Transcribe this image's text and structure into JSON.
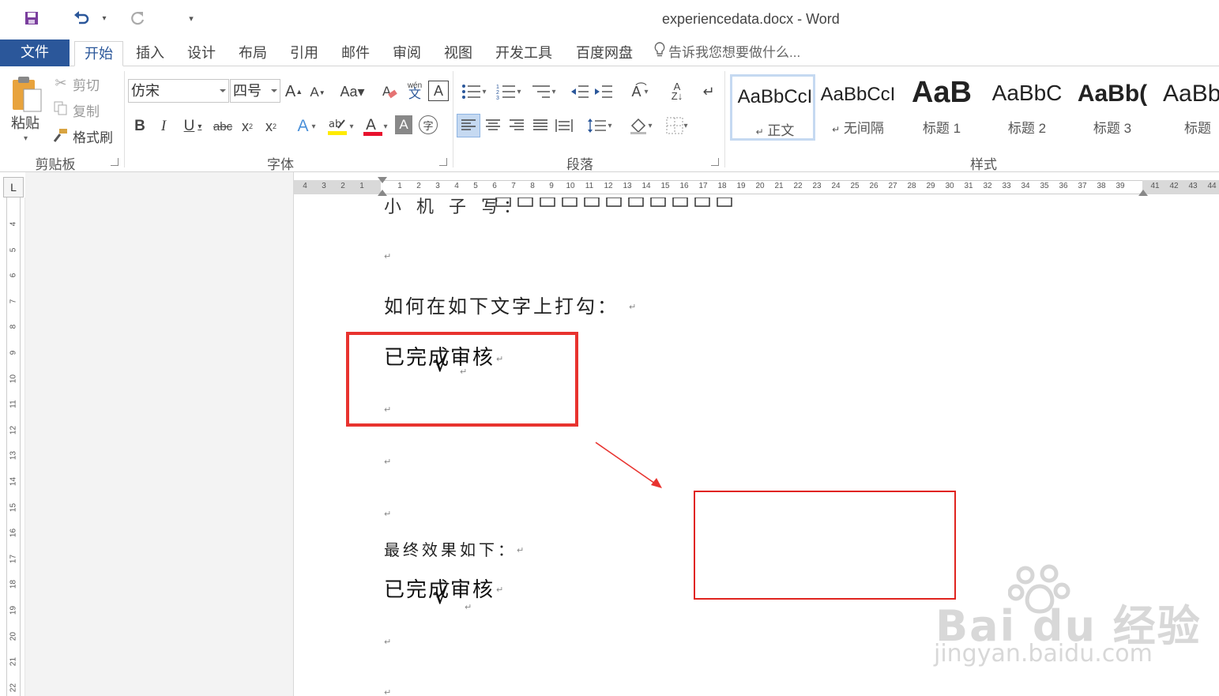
{
  "window": {
    "title": "experiencedata.docx - Word"
  },
  "tabs": [
    "文件",
    "开始",
    "插入",
    "设计",
    "布局",
    "引用",
    "邮件",
    "审阅",
    "视图",
    "开发工具",
    "百度网盘"
  ],
  "tell_me": "告诉我您想要做什么...",
  "clipboard": {
    "paste": "粘贴",
    "cut": "剪切",
    "copy": "复制",
    "format_painter": "格式刷",
    "label": "剪贴板"
  },
  "font": {
    "name": "仿宋",
    "size": "四号",
    "label": "字体"
  },
  "paragraph": {
    "label": "段落"
  },
  "styles": {
    "label": "样式",
    "items": [
      {
        "sample": "AaBbCcI",
        "name": "正文"
      },
      {
        "sample": "AaBbCcI",
        "name": "无间隔"
      },
      {
        "sample": "AaB",
        "name": "标题 1"
      },
      {
        "sample": "AaBbC",
        "name": "标题 2"
      },
      {
        "sample": "AaBb(",
        "name": "标题 3"
      },
      {
        "sample": "AaBb",
        "name": "标题"
      }
    ]
  },
  "ruler": {
    "left_ticks": [
      "4",
      "3",
      "2",
      "1"
    ],
    "right_ticks": [
      "1",
      "2",
      "3",
      "4",
      "5",
      "6",
      "7",
      "8",
      "9",
      "10",
      "11",
      "12",
      "13",
      "14",
      "15",
      "16",
      "17",
      "18",
      "19",
      "20",
      "21",
      "22",
      "23",
      "24",
      "25",
      "26",
      "27",
      "28",
      "29",
      "30",
      "31",
      "32",
      "33",
      "34",
      "35",
      "36",
      "37",
      "38",
      "39",
      "41",
      "42",
      "43",
      "44"
    ],
    "vertical_ticks": [
      "4",
      "5",
      "6",
      "7",
      "8",
      "9",
      "10",
      "11",
      "12",
      "13",
      "14",
      "15",
      "16",
      "17",
      "18",
      "19",
      "20",
      "21",
      "22"
    ]
  },
  "document": {
    "line_top": "小 机 子 写：",
    "question": "如何在如下文字上打勾：",
    "checked_text": "已完成审核",
    "result_label": "最终效果如下：",
    "checked_text_2": "已完成审核",
    "checkmark": "√",
    "para_mark": "↵"
  },
  "watermark": {
    "brand": "Bai du 经验",
    "url": "jingyan.baidu.com"
  },
  "colors": {
    "accent": "#2b579a",
    "highlight_box": "#e8332f"
  }
}
